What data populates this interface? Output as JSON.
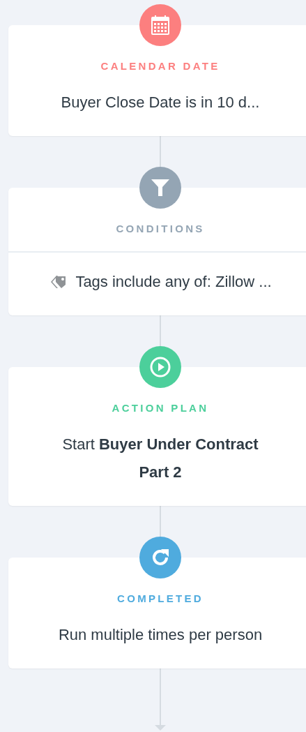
{
  "steps": [
    {
      "kind": "calendar",
      "color": "#fc7f7f",
      "label": "CALENDAR DATE",
      "text": "Buyer Close Date is in 10 d..."
    },
    {
      "kind": "conditions",
      "color": "#94a5b4",
      "label": "CONDITIONS",
      "text": "Tags include any of: Zillow ..."
    },
    {
      "kind": "action",
      "color": "#4ccf9b",
      "label": "ACTION PLAN",
      "text": "Start **Buyer Under Contract Part 2**"
    },
    {
      "kind": "completed",
      "color": "#4fabde",
      "label": "COMPLETED",
      "text": "Run multiple times per person"
    }
  ]
}
